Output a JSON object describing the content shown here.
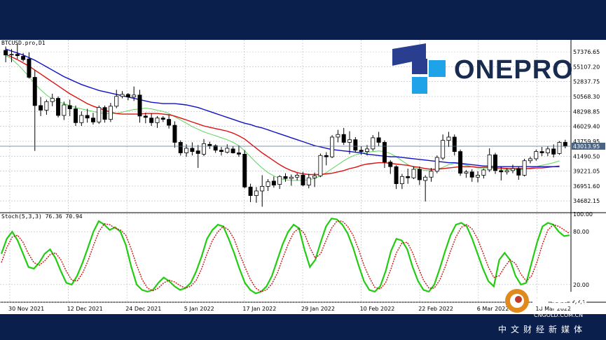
{
  "chart_data": [
    {
      "type": "candlestick",
      "symbol_label": "BTCUSD.pro,D1",
      "y_ticks": [
        "57376.65",
        "55107.20",
        "52837.75",
        "50568.30",
        "48298.85",
        "46029.40",
        "43759.95",
        "41490.50",
        "39221.05",
        "36951.60",
        "34682.15"
      ],
      "current_price_label": "43013.95",
      "current_price": 43013.95,
      "x_ticks": [
        "30 Nov 2021",
        "12 Dec 2021",
        "24 Dec 2021",
        "5 Jan 2022",
        "17 Jan 2022",
        "29 Jan 2022",
        "10 Feb 2022",
        "22 Feb 2022",
        "6 Mar 2022",
        "18 Mar 2022"
      ],
      "ylim": [
        33000,
        59200
      ],
      "candles": [
        [
          57600,
          58200,
          55800,
          56900
        ],
        [
          56900,
          57800,
          55800,
          57000
        ],
        [
          57000,
          58600,
          56300,
          56800
        ],
        [
          56700,
          57200,
          55900,
          56200
        ],
        [
          56300,
          57300,
          53300,
          53500
        ],
        [
          53500,
          54600,
          42300,
          49200
        ],
        [
          49200,
          50500,
          47600,
          48500
        ],
        [
          48500,
          50100,
          47800,
          49800
        ],
        [
          49800,
          51000,
          49100,
          50300
        ],
        [
          50300,
          50600,
          47400,
          47700
        ],
        [
          47700,
          49800,
          47000,
          49300
        ],
        [
          49200,
          50100,
          47600,
          48700
        ],
        [
          48700,
          49200,
          46100,
          46600
        ],
        [
          46600,
          48300,
          46100,
          47700
        ],
        [
          47700,
          48700,
          46600,
          47300
        ],
        [
          47300,
          48100,
          46300,
          46700
        ],
        [
          46700,
          49200,
          46400,
          48900
        ],
        [
          48900,
          49200,
          46600,
          47100
        ],
        [
          47100,
          49600,
          46700,
          49100
        ],
        [
          49100,
          51600,
          48800,
          50600
        ],
        [
          50600,
          51400,
          50300,
          50900
        ],
        [
          50900,
          51100,
          50000,
          50500
        ],
        [
          50500,
          52100,
          49900,
          50800
        ],
        [
          50800,
          51600,
          46600,
          47600
        ],
        [
          47600,
          48100,
          46500,
          47400
        ],
        [
          47300,
          48000,
          46100,
          46600
        ],
        [
          46600,
          47600,
          45800,
          47300
        ],
        [
          47300,
          47600,
          46700,
          47100
        ],
        [
          47100,
          47800,
          45700,
          46200
        ],
        [
          46200,
          46800,
          42800,
          43600
        ],
        [
          43600,
          43900,
          41600,
          42000
        ],
        [
          42000,
          43300,
          41400,
          42700
        ],
        [
          42700,
          43600,
          41600,
          42200
        ],
        [
          42300,
          43200,
          39700,
          41900
        ],
        [
          41800,
          44100,
          41500,
          43400
        ],
        [
          43300,
          43700,
          42600,
          43100
        ],
        [
          43100,
          43300,
          42000,
          42400
        ],
        [
          42400,
          42900,
          41600,
          42200
        ],
        [
          42100,
          43300,
          41900,
          42700
        ],
        [
          42600,
          43000,
          41900,
          42000
        ],
        [
          42000,
          43100,
          41400,
          41800
        ],
        [
          41800,
          42400,
          36600,
          36800
        ],
        [
          36800,
          37300,
          34500,
          35500
        ],
        [
          35500,
          36800,
          34400,
          36200
        ],
        [
          36200,
          38600,
          33800,
          36900
        ],
        [
          36900,
          38000,
          36200,
          37600
        ],
        [
          37700,
          38400,
          36700,
          37100
        ],
        [
          37200,
          38600,
          36500,
          38400
        ],
        [
          38400,
          38900,
          37600,
          38100
        ],
        [
          38100,
          38700,
          37000,
          38300
        ],
        [
          38300,
          38900,
          37800,
          38600
        ],
        [
          38600,
          39100,
          36900,
          37100
        ],
        [
          37100,
          38800,
          36600,
          38200
        ],
        [
          38200,
          39000,
          36800,
          38500
        ],
        [
          38500,
          41900,
          38300,
          41600
        ],
        [
          41600,
          42100,
          40100,
          41400
        ],
        [
          41400,
          44700,
          41200,
          44400
        ],
        [
          44400,
          45500,
          43600,
          44800
        ],
        [
          44800,
          45800,
          43200,
          43600
        ],
        [
          43600,
          45300,
          41800,
          44000
        ],
        [
          44000,
          44400,
          42100,
          42400
        ],
        [
          42400,
          43000,
          41700,
          42200
        ],
        [
          42200,
          43200,
          41600,
          42600
        ],
        [
          42600,
          44700,
          42300,
          44300
        ],
        [
          44300,
          45200,
          43000,
          43600
        ],
        [
          43600,
          43900,
          39700,
          40600
        ],
        [
          40600,
          40900,
          38800,
          39900
        ],
        [
          39900,
          40100,
          36500,
          37300
        ],
        [
          37300,
          38800,
          36500,
          38400
        ],
        [
          38400,
          39600,
          37300,
          38200
        ],
        [
          38200,
          39900,
          38000,
          39500
        ],
        [
          39500,
          39900,
          37100,
          37900
        ],
        [
          37800,
          38600,
          34600,
          38300
        ],
        [
          38300,
          39700,
          37600,
          39200
        ],
        [
          39200,
          41600,
          38900,
          41300
        ],
        [
          41200,
          44800,
          40900,
          43900
        ],
        [
          43900,
          45200,
          42900,
          44400
        ],
        [
          44400,
          44800,
          41600,
          42200
        ],
        [
          42200,
          42500,
          38500,
          38900
        ],
        [
          38900,
          39400,
          38200,
          39100
        ],
        [
          39100,
          39500,
          37600,
          38300
        ],
        [
          38300,
          39200,
          37500,
          38600
        ],
        [
          38600,
          39600,
          38100,
          39400
        ],
        [
          39400,
          42700,
          39100,
          41700
        ],
        [
          41700,
          42000,
          38800,
          39300
        ],
        [
          39300,
          39900,
          37800,
          39100
        ],
        [
          39100,
          39700,
          38700,
          39300
        ],
        [
          39300,
          40200,
          38900,
          39600
        ],
        [
          39600,
          39900,
          37900,
          38600
        ],
        [
          38600,
          41100,
          38400,
          40800
        ],
        [
          40800,
          41400,
          40400,
          41100
        ],
        [
          41100,
          42500,
          40800,
          42200
        ],
        [
          42200,
          42900,
          41500,
          42000
        ],
        [
          42000,
          43000,
          41500,
          42600
        ],
        [
          42600,
          43300,
          41300,
          41800
        ],
        [
          41900,
          43800,
          41700,
          43600
        ],
        [
          43600,
          44000,
          42700,
          43014
        ]
      ],
      "ma_blue": [
        57800,
        57500,
        57200,
        56900,
        56500,
        56100,
        55600,
        55100,
        54600,
        54100,
        53600,
        53200,
        52800,
        52400,
        52100,
        51800,
        51500,
        51300,
        51100,
        50900,
        50700,
        50500,
        50300,
        50100,
        49900,
        49700,
        49600,
        49500,
        49500,
        49500,
        49400,
        49300,
        49100,
        48900,
        48600,
        48300,
        48000,
        47700,
        47400,
        47100,
        46800,
        46500,
        46300,
        46000,
        45800,
        45500,
        45200,
        44900,
        44600,
        44300,
        44000,
        43700,
        43400,
        43100,
        42900,
        42700,
        42500,
        42400,
        42300,
        42200,
        42100,
        42000,
        41800,
        41700,
        41600,
        41500,
        41400,
        41400,
        41300,
        41200,
        41100,
        41000,
        40900,
        40800,
        40700,
        40600,
        40500,
        40500,
        40400,
        40300,
        40200,
        40100,
        40000,
        40000,
        39900,
        39900,
        39900,
        39900,
        39900,
        39900,
        39900,
        39900,
        39900,
        39900,
        39900,
        39900
      ],
      "ma_red": [
        57000,
        56600,
        56200,
        55700,
        55200,
        54600,
        54000,
        53400,
        52800,
        52200,
        51600,
        51000,
        50500,
        50000,
        49500,
        49100,
        48800,
        48500,
        48200,
        48000,
        47900,
        47900,
        47900,
        47900,
        48000,
        48000,
        48000,
        47900,
        47800,
        47600,
        47300,
        47000,
        46700,
        46400,
        46100,
        45900,
        45700,
        45500,
        45300,
        45000,
        44600,
        44100,
        43400,
        42700,
        42000,
        41400,
        40800,
        40200,
        39700,
        39300,
        39000,
        38800,
        38700,
        38700,
        38700,
        38800,
        38900,
        39100,
        39300,
        39600,
        39800,
        40100,
        40300,
        40400,
        40500,
        40500,
        40400,
        40300,
        40200,
        40100,
        39900,
        39800,
        39600,
        39500,
        39500,
        39600,
        39700,
        39800,
        39900,
        39900,
        39900,
        39800,
        39800,
        39800,
        39700,
        39700,
        39600,
        39600,
        39600,
        39600,
        39600,
        39700,
        39700,
        39800,
        39900,
        40000
      ],
      "ma_green": [
        56800,
        56300,
        55500,
        54600,
        53600,
        52500,
        51600,
        50800,
        50200,
        49800,
        49500,
        49200,
        48900,
        48700,
        48500,
        48300,
        48100,
        48000,
        48000,
        48000,
        48200,
        48400,
        48600,
        48700,
        48800,
        48700,
        48500,
        48300,
        48000,
        47500,
        47000,
        46500,
        46000,
        45600,
        45200,
        44900,
        44600,
        44300,
        44000,
        43600,
        43100,
        42300,
        41400,
        40500,
        39700,
        39000,
        38500,
        38100,
        37900,
        37800,
        37800,
        37800,
        37900,
        38100,
        38500,
        39000,
        39600,
        40200,
        40800,
        41300,
        41700,
        41900,
        42100,
        42200,
        42300,
        42200,
        41900,
        41400,
        40800,
        40200,
        39800,
        39500,
        39300,
        39300,
        39500,
        39800,
        40200,
        40400,
        40300,
        40100,
        39900,
        39700,
        39700,
        39700,
        39600,
        39500,
        39500,
        39500,
        39400,
        39500,
        39700,
        39900,
        40100,
        40300,
        40500,
        40800
      ]
    },
    {
      "type": "line",
      "indicator_label": "Stoch(5,3,3) 76.36 70.94",
      "y_ticks": [
        "100.00",
        "80.00",
        "20.00",
        "0.00"
      ],
      "ylim": [
        0,
        100
      ],
      "main": [
        55,
        72,
        80,
        70,
        55,
        40,
        38,
        45,
        55,
        60,
        50,
        35,
        22,
        20,
        30,
        45,
        62,
        80,
        92,
        88,
        82,
        85,
        80,
        65,
        40,
        20,
        14,
        12,
        14,
        22,
        28,
        24,
        18,
        14,
        16,
        22,
        35,
        52,
        72,
        82,
        88,
        86,
        72,
        56,
        38,
        22,
        14,
        10,
        12,
        18,
        30,
        48,
        66,
        80,
        88,
        84,
        60,
        40,
        48,
        68,
        86,
        95,
        94,
        88,
        78,
        62,
        42,
        24,
        14,
        12,
        18,
        35,
        58,
        72,
        70,
        60,
        40,
        24,
        14,
        12,
        20,
        38,
        58,
        76,
        88,
        90,
        86,
        72,
        55,
        38,
        24,
        18,
        48,
        56,
        48,
        30,
        20,
        22,
        45,
        68,
        86,
        90,
        88,
        80,
        75,
        76
      ],
      "signal": [
        45,
        62,
        74,
        76,
        68,
        55,
        45,
        42,
        47,
        54,
        56,
        48,
        35,
        25,
        24,
        33,
        47,
        64,
        80,
        89,
        88,
        84,
        82,
        76,
        60,
        42,
        26,
        16,
        13,
        16,
        22,
        25,
        23,
        19,
        16,
        18,
        25,
        38,
        55,
        70,
        80,
        86,
        82,
        72,
        55,
        40,
        26,
        16,
        12,
        14,
        21,
        33,
        50,
        66,
        79,
        84,
        78,
        62,
        50,
        55,
        70,
        84,
        92,
        92,
        86,
        76,
        60,
        42,
        28,
        17,
        15,
        22,
        38,
        56,
        67,
        68,
        56,
        40,
        25,
        16,
        16,
        25,
        40,
        58,
        74,
        85,
        88,
        83,
        72,
        56,
        40,
        28,
        30,
        40,
        48,
        44,
        32,
        24,
        30,
        46,
        66,
        82,
        88,
        86,
        82,
        78
      ]
    }
  ],
  "branding": {
    "logo_text": "ONEPRO"
  },
  "watermark": {
    "site_name": "中金网",
    "url": "CNGOLD.COM.CN",
    "tagline": "中文财经新媒体"
  }
}
